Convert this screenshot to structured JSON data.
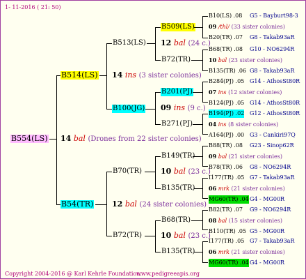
{
  "header": {
    "date": "1- 11-2016 ( 21: 50)"
  },
  "footer": {
    "copyright": "Copyright 2004-2016 @ Karl Kehrle Foundation.",
    "site": "www.pedigreeapis.org"
  },
  "root": {
    "name": "B554(LS)",
    "num": "14",
    "bal": "bal",
    "note": "(Drones from 22 sister colonies)"
  },
  "gen1": [
    {
      "name": "B514(LS)",
      "num": "14",
      "bal": "ins",
      "note": "(3 sister colonies)"
    },
    {
      "name": "B54(TR)",
      "num": "12",
      "bal": "bal",
      "note": "(24 sister colonies)"
    }
  ],
  "gen2": [
    {
      "name": "B513(LS)"
    },
    {
      "name": "B100(JG)",
      "num": "09",
      "bal": "ins",
      "note": "(9 c.)"
    },
    {
      "name": "B70(TR)",
      "num": "10",
      "bal": "bal",
      "note": "(23 c.)"
    },
    {
      "name": "B72(TR)",
      "num": "10",
      "bal": "bal",
      "note": "(23 c.)"
    }
  ],
  "gen3": [
    {
      "name": "B509(LS)",
      "num": "12",
      "bal": "bal",
      "note": "(24 c.)"
    },
    {
      "name": "B72(TR)"
    },
    {
      "name": "B201(PJ)",
      "num": "09",
      "bal": "ins",
      "note": "(9 c.)"
    },
    {
      "name": "B271(PJ)"
    },
    {
      "name": "B149(TR)",
      "num": "10",
      "bal": "bal",
      "note": "(23 c.)"
    },
    {
      "name": "B135(TR)"
    },
    {
      "name": "B68(TR)",
      "num": "10",
      "bal": "bal",
      "note": "(23 c.)"
    },
    {
      "name": "B135(TR)"
    }
  ],
  "gen4": [
    {
      "top": "B10(LS) .08",
      "top_right": "G5 - Bayburt98-3",
      "mid_num": "09",
      "mid_bal": "/thl/",
      "mid_note": "(33 sister colonies)",
      "bot": "B20(TR) .07",
      "bot_right": "G8 - Takab93aR"
    },
    {
      "top": "B68(TR) .08",
      "top_right": "G10 - NO6294R",
      "mid_num": "10",
      "mid_bal": "bal",
      "mid_note": "(23 sister colonies)",
      "bot": "B135(TR) .06",
      "bot_right": "G8 - Takab93aR"
    },
    {
      "top": "B284(PJ) .05",
      "top_right": "G14 - AthosSt80R",
      "mid_num": "07",
      "mid_bal": "ins",
      "mid_note": "(12 sister colonies)",
      "bot": "B124(PJ) .05",
      "bot_right": "G14 - AthosSt80R"
    },
    {
      "top": "B194(PJ) .02",
      "top_right": "G12 - AthosSt80R",
      "mid_num": "04",
      "mid_bal": "ins",
      "mid_note": "(8 sister colonies)",
      "bot": "A164(PJ) .00",
      "bot_right": "G3 - Cankiri97Q"
    },
    {
      "top": "B88(TR) .08",
      "top_right": "G23 - Sinop62R",
      "mid_num": "09",
      "mid_bal": "bal",
      "mid_note": "(21 sister colonies)",
      "bot": "B78(TR) .06",
      "bot_right": "G8 - NO6294R"
    },
    {
      "top": "I177(TR) .05",
      "top_right": "G7 - Takab93aR",
      "mid_num": "06",
      "mid_bal": "mrk",
      "mid_note": "(21 sister colonies)",
      "bot": "MG60(TR) .04",
      "bot_right": "G4 - MG00R"
    },
    {
      "top": "B82(TR) .07",
      "top_right": "G9 - NO6294R",
      "mid_num": "08",
      "mid_bal": "bal",
      "mid_note": "(15 sister colonies)",
      "bot": "B110(TR) .05",
      "bot_right": "G5 - MG00R"
    },
    {
      "top": "I177(TR) .05",
      "top_right": "G7 - Takab93aR",
      "mid_num": "06",
      "mid_bal": "mrk",
      "mid_note": "(21 sister colonies)",
      "bot": "MG60(TR) .04",
      "bot_right": "G4 - MG00R"
    }
  ]
}
